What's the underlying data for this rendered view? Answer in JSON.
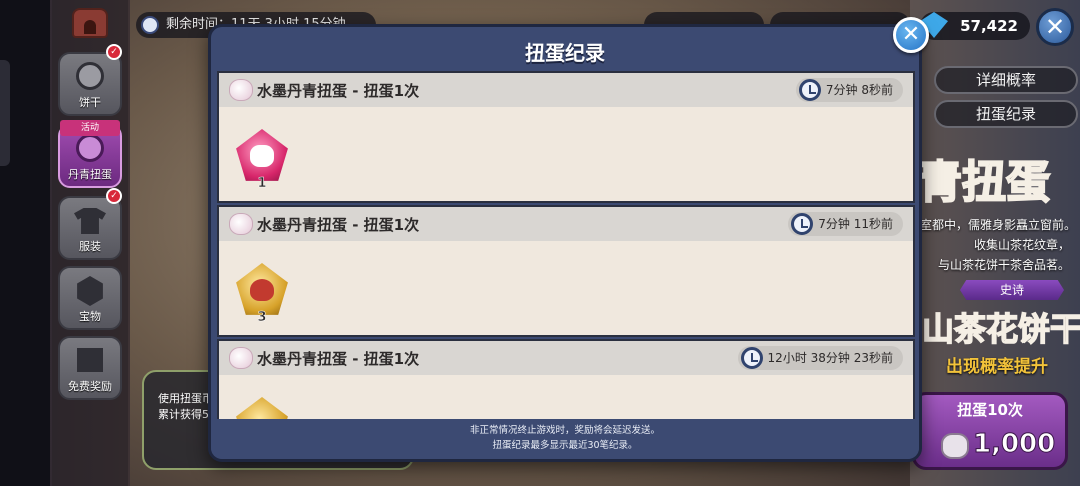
{
  "background": {
    "timer_text": "剩余时间：11天 3小时 15分钟",
    "crystals": "57,422",
    "sidebar": [
      {
        "label": "饼干",
        "badge": true
      },
      {
        "label": "丹青扭蛋",
        "tag": "活动",
        "active": true
      },
      {
        "label": "服装",
        "badge": true
      },
      {
        "label": "宝物"
      },
      {
        "label": "免费奖励"
      }
    ],
    "right_buttons": [
      "详细概率",
      "扭蛋纪录"
    ],
    "banner_title": "青扭蛋",
    "story_lines": [
      "室都中，儒雅身影矗立窗前。",
      "收集山茶花纹章，",
      "与山茶花饼干茶舍品茗。"
    ],
    "rarity": "史诗",
    "cookie_name": "山茶花饼干",
    "rate_up": "出现概率提升",
    "pull10": {
      "label": "扭蛋10次",
      "price": "1,000"
    },
    "bottom_card": {
      "line1": "使用扭蛋币",
      "line2": "累计获得5"
    }
  },
  "modal": {
    "title": "扭蛋纪录",
    "close_icon": "close-icon",
    "entries": [
      {
        "title": "水墨丹青扭蛋 - 扭蛋1次",
        "time": "7分钟 8秒前",
        "item": {
          "qty": "1",
          "gem": "pink"
        }
      },
      {
        "title": "水墨丹青扭蛋 - 扭蛋1次",
        "time": "7分钟 11秒前",
        "item": {
          "qty": "3",
          "gem": "gold"
        }
      },
      {
        "title": "水墨丹青扭蛋 - 扭蛋1次",
        "time": "12小时 38分钟 23秒前",
        "item": {
          "gem": "gold"
        }
      }
    ],
    "notes": [
      "非正常情况终止游戏时，奖励将会延迟发送。",
      "扭蛋纪录最多显示最近30笔纪录。"
    ]
  }
}
